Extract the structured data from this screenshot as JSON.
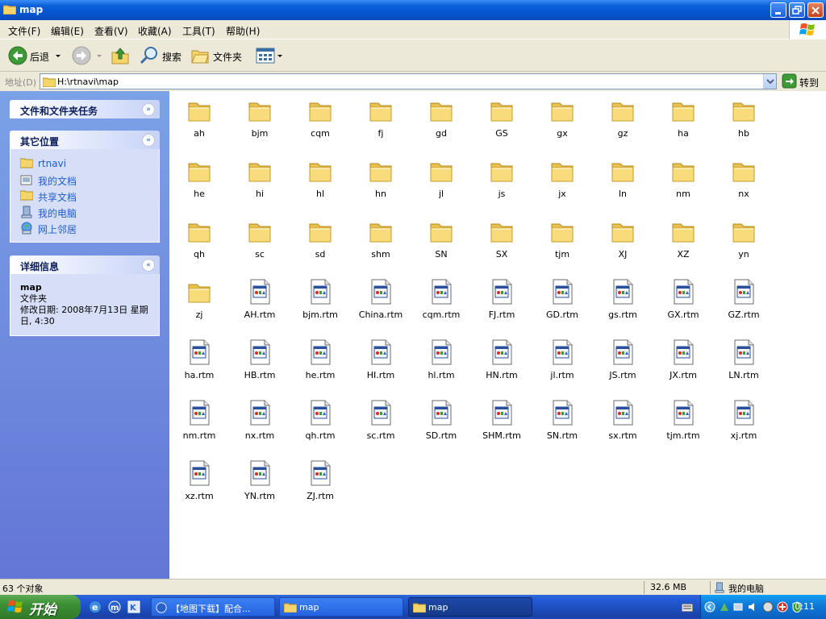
{
  "window": {
    "title": "map"
  },
  "menu": [
    "文件(F)",
    "编辑(E)",
    "查看(V)",
    "收藏(A)",
    "工具(T)",
    "帮助(H)"
  ],
  "toolbar": {
    "back": "后退",
    "search": "搜索",
    "folders": "文件夹"
  },
  "address": {
    "label": "地址(D)",
    "value": "H:\\rtnavi\\map",
    "go": "转到"
  },
  "left": {
    "tasks_title": "文件和文件夹任务",
    "places_title": "其它位置",
    "places": [
      "rtnavi",
      "我的文档",
      "共享文档",
      "我的电脑",
      "网上邻居"
    ],
    "details_title": "详细信息",
    "details_name": "map",
    "details_type": "文件夹",
    "details_modified": "修改日期: 2008年7月13日 星期日, 4:30"
  },
  "folders": [
    "ah",
    "bjm",
    "cqm",
    "fj",
    "gd",
    "GS",
    "gx",
    "gz",
    "ha",
    "hb",
    "he",
    "hi",
    "hl",
    "hn",
    "jl",
    "js",
    "jx",
    "ln",
    "nm",
    "nx",
    "qh",
    "sc",
    "sd",
    "shm",
    "SN",
    "SX",
    "tjm",
    "XJ",
    "XZ",
    "yn",
    "zj"
  ],
  "files": [
    "AH.rtm",
    "bjm.rtm",
    "China.rtm",
    "cqm.rtm",
    "FJ.rtm",
    "GD.rtm",
    "gs.rtm",
    "GX.rtm",
    "GZ.rtm",
    "ha.rtm",
    "HB.rtm",
    "he.rtm",
    "HI.rtm",
    "hl.rtm",
    "HN.rtm",
    "jl.rtm",
    "JS.rtm",
    "JX.rtm",
    "LN.rtm",
    "nm.rtm",
    "nx.rtm",
    "qh.rtm",
    "sc.rtm",
    "SD.rtm",
    "SHM.rtm",
    "SN.rtm",
    "sx.rtm",
    "tjm.rtm",
    "xj.rtm",
    "xz.rtm",
    "YN.rtm",
    "ZJ.rtm"
  ],
  "status": {
    "count": "63 个对象",
    "size": "32.6 MB",
    "location": "我的电脑"
  },
  "taskbar": {
    "start": "开始",
    "tasks": [
      "【地图下载】配合...",
      "map",
      "map"
    ],
    "clock": "0:11"
  },
  "colors": {
    "titlebar": "#0554d0",
    "panel_link": "#215dc6",
    "start": "#3c8f34",
    "folder": "#f5d46a"
  }
}
